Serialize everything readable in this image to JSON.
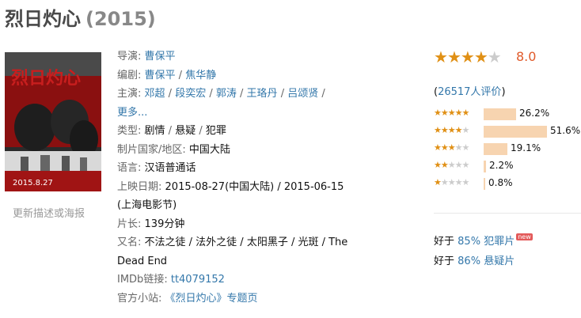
{
  "movie": {
    "title": "烈日灼心",
    "year": "(2015)"
  },
  "poster": {
    "text": "烈日灼心",
    "date": "2015.8.27"
  },
  "update_link": "更新描述或海报",
  "info": {
    "director_label": "导演:",
    "director": "曹保平",
    "writer_label": "编剧:",
    "writers": [
      "曹保平",
      "焦华静"
    ],
    "cast_label": "主演:",
    "cast": [
      "邓超",
      "段奕宏",
      "郭涛",
      "王珞丹",
      "吕颂贤"
    ],
    "more": "更多...",
    "genre_label": "类型:",
    "genres": [
      "剧情",
      "悬疑",
      "犯罪"
    ],
    "country_label": "制片国家/地区:",
    "country": "中国大陆",
    "language_label": "语言:",
    "language": "汉语普通话",
    "release_label": "上映日期:",
    "release": "2015-08-27(中国大陆) / 2015-06-15(上海电影节)",
    "runtime_label": "片长:",
    "runtime": "139分钟",
    "aka_label": "又名:",
    "aka": "不法之徒 / 法外之徒 / 太阳黑子 / 光斑 / The Dead End",
    "imdb_label": "IMDb链接:",
    "imdb": "tt4079152",
    "site_label": "官方小站:",
    "site": "《烈日灼心》专题页"
  },
  "rating": {
    "score": "8.0",
    "stars_value": 4,
    "votes_open": "(",
    "votes_count": "26517人评价",
    "votes_close": ")",
    "distribution": [
      {
        "stars": 5,
        "pct_label": "26.2%",
        "pct": 26.2
      },
      {
        "stars": 4,
        "pct_label": "51.6%",
        "pct": 51.6
      },
      {
        "stars": 3,
        "pct_label": "19.1%",
        "pct": 19.1
      },
      {
        "stars": 2,
        "pct_label": "2.2%",
        "pct": 2.2
      },
      {
        "stars": 1,
        "pct_label": "0.8%",
        "pct": 0.8
      }
    ],
    "colors": {
      "star": "#e09015",
      "bar": "#f7d4b0",
      "score": "#e05a2a",
      "link": "#3377aa"
    }
  },
  "better_than": [
    {
      "prefix": "好于",
      "pct": "85%",
      "genre": "犯罪片",
      "new": "new"
    },
    {
      "prefix": "好于",
      "pct": "86%",
      "genre": "悬疑片",
      "new": ""
    }
  ]
}
